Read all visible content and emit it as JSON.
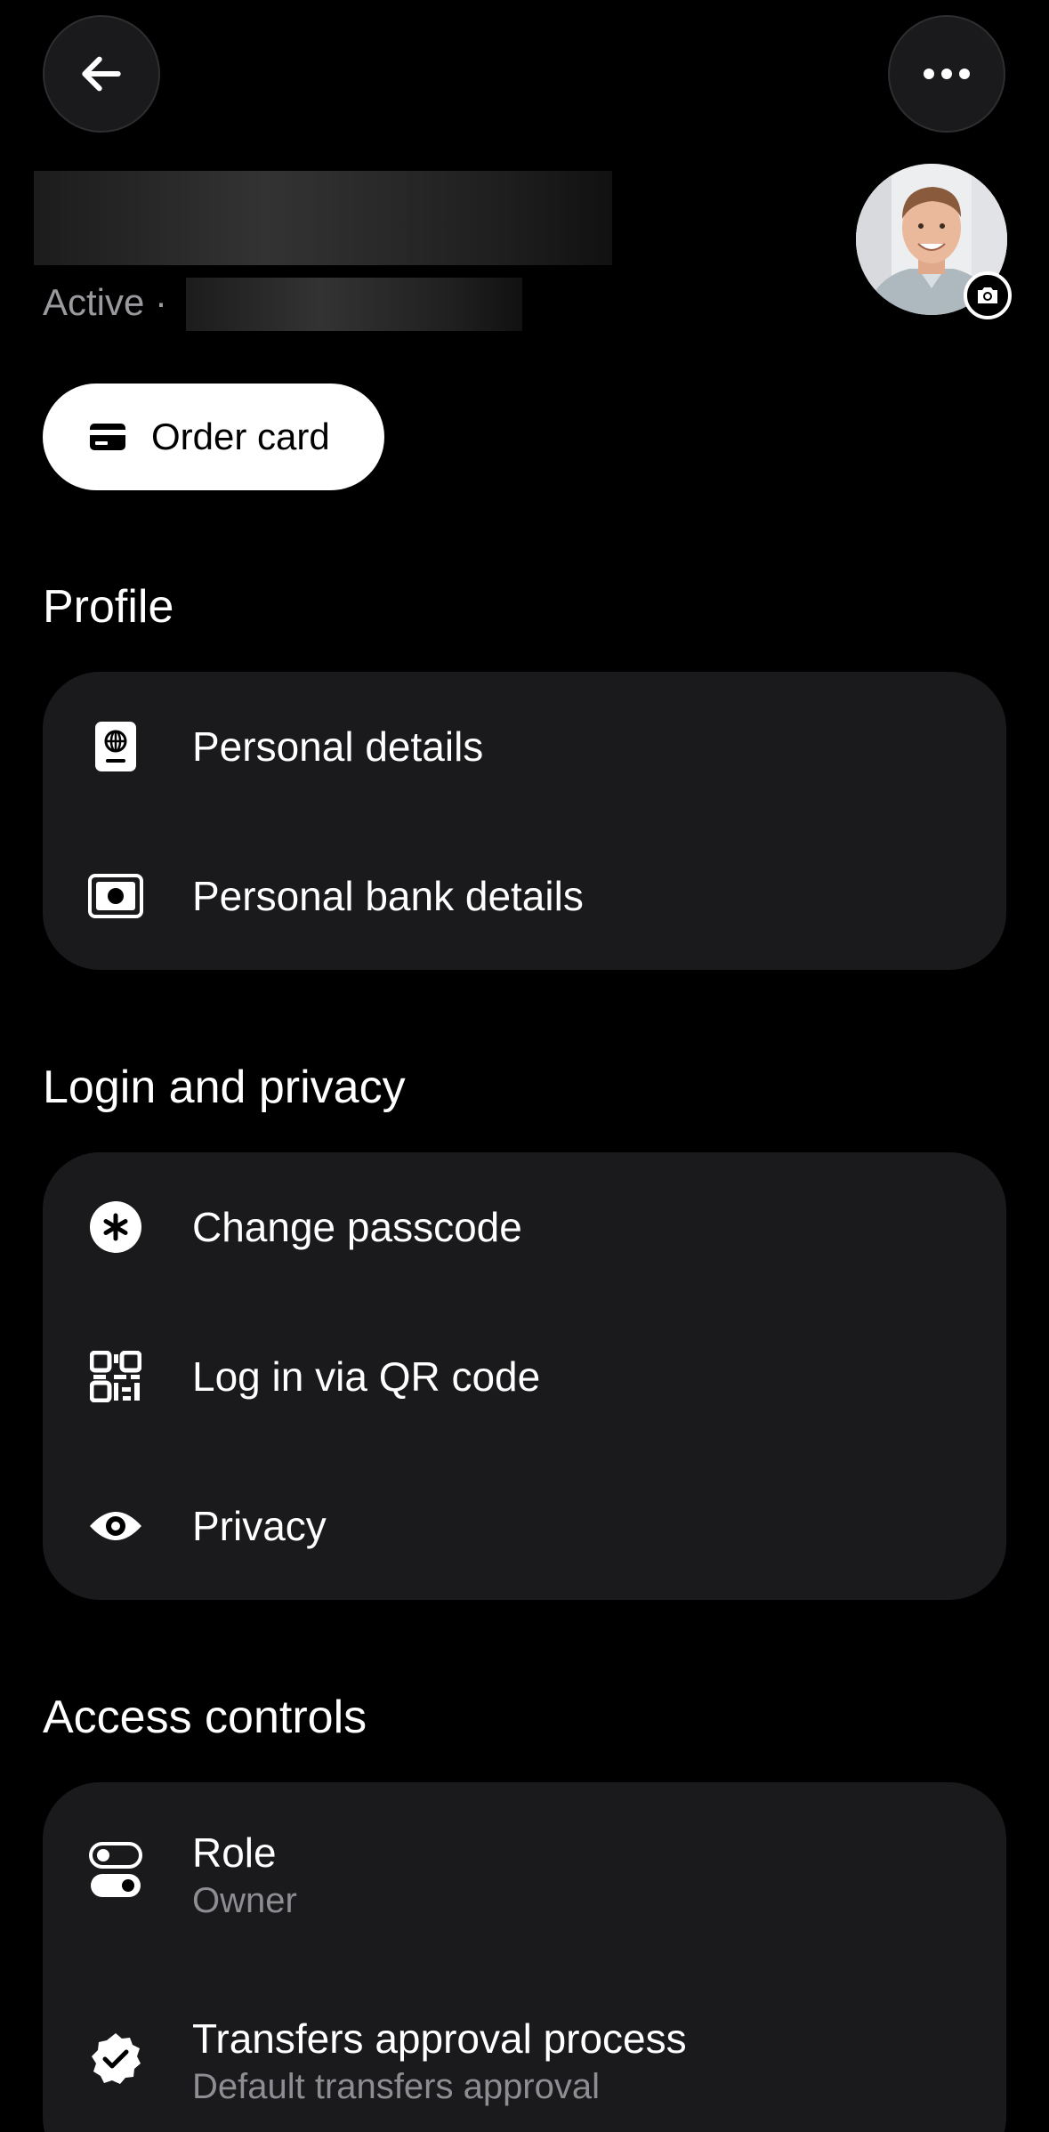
{
  "header": {
    "back_icon": "arrow-left-icon",
    "more_icon": "more-horizontal-icon"
  },
  "profile_header": {
    "status": "Active ·",
    "avatar_badge_icon": "camera-icon"
  },
  "order_card": {
    "label": "Order card",
    "icon": "card-icon"
  },
  "sections": {
    "profile": {
      "title": "Profile",
      "items": [
        {
          "label": "Personal details",
          "icon": "passport-icon"
        },
        {
          "label": "Personal bank details",
          "icon": "banknote-icon"
        }
      ]
    },
    "login": {
      "title": "Login and privacy",
      "items": [
        {
          "label": "Change passcode",
          "icon": "asterisk-icon"
        },
        {
          "label": "Log in via QR code",
          "icon": "qr-code-icon"
        },
        {
          "label": "Privacy",
          "icon": "eye-icon"
        }
      ]
    },
    "access": {
      "title": "Access controls",
      "items": [
        {
          "label": "Role",
          "sublabel": "Owner",
          "icon": "toggle-icon"
        },
        {
          "label": "Transfers approval process",
          "sublabel": "Default transfers approval",
          "icon": "verified-badge-icon"
        }
      ]
    }
  },
  "colors": {
    "background": "#000000",
    "card": "#1a1a1c",
    "secondary_text": "#8d8d92",
    "button_bg": "#ffffff"
  }
}
